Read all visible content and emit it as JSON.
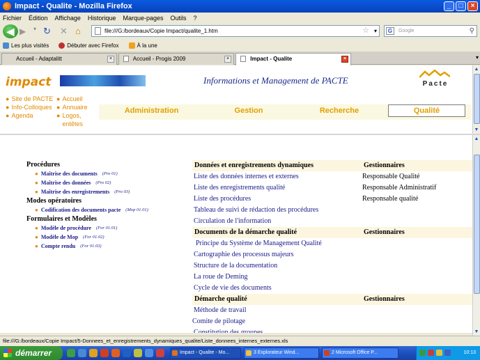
{
  "window": {
    "title": "Impact - Qualite - Mozilla Firefox",
    "buttons": [
      "_",
      "□",
      "×"
    ]
  },
  "menu": [
    "Fichier",
    "Édition",
    "Affichage",
    "Historique",
    "Marque-pages",
    "Outils",
    "?"
  ],
  "nav": {
    "url": "file:///G:/bordeaux/Copie Impact/qualite_1.htm",
    "search_placeholder": "Google"
  },
  "bookmarks": [
    "Les plus visités",
    "Débuter avec Firefox",
    "À la une"
  ],
  "tabs": [
    {
      "label": "Accueil - Adaptalitt"
    },
    {
      "label": "Accueil - Progis 2009"
    },
    {
      "label": "Impact - Qualite",
      "active": true
    }
  ],
  "header": {
    "logo": "impact",
    "title": "Informations et Management de PACTE",
    "pacte_logo": "Pacte",
    "left_links_col1": [
      "Site de PACTE",
      "Info-Colloques",
      "Agenda"
    ],
    "left_links_col2": [
      "Accueil",
      "Annuaire",
      "Logos,",
      "entêtes"
    ],
    "main_nav": [
      "Administration",
      "Gestion",
      "Recherche",
      "Qualité"
    ],
    "main_nav_selected": "Qualité"
  },
  "left_panel": {
    "sections": [
      {
        "heading": "Procédures",
        "items": [
          {
            "label": "Maîtrise des documents",
            "version": "(Pro 01)"
          },
          {
            "label": "Maîtrise des données",
            "version": "(Pro 02)"
          },
          {
            "label": "Maîtrise des enregistrements",
            "version": "(Pro 03)"
          }
        ]
      },
      {
        "heading": "Modes opératoires",
        "items": [
          {
            "label": "Codification des documents pacte",
            "version": "(Mop 01.01)"
          }
        ]
      },
      {
        "heading": "Formulaires et Modèles",
        "items": [
          {
            "label": "Modèle de procédure",
            "version": "(For 01.01)"
          },
          {
            "label": "Modèle de Mop",
            "version": "(For 01.02)"
          },
          {
            "label": "Compte rendu",
            "version": "(For 01.03)"
          }
        ]
      }
    ]
  },
  "table": {
    "sections": [
      {
        "heading": "Données et enregistrements dynamiques",
        "col2": "Gestionnaires",
        "rows": [
          {
            "doc": "Liste des données internes et externes",
            "owner": "Responsable Qualité"
          },
          {
            "doc": "Liste des enregistrements qualité",
            "owner": "Responsable Administratif"
          },
          {
            "doc": "Liste des procédures",
            "owner": "Responsable qualité"
          },
          {
            "doc": "Tableau de suivi de rédaction des procédures",
            "owner": ""
          },
          {
            "doc": "Circulation de l'information",
            "owner": ""
          }
        ]
      },
      {
        "heading": "Documents de la démarche qualité",
        "col2": "Gestionnaires",
        "rows": [
          {
            "doc": "Principe du Système de Management Qualité",
            "owner": ""
          },
          {
            "doc": "Cartographie des processus majeurs",
            "owner": ""
          },
          {
            "doc": "Structure de la documentation",
            "owner": ""
          },
          {
            "doc": "La roue de Deming",
            "owner": ""
          },
          {
            "doc": "Cycle de vie des documents",
            "owner": ""
          }
        ]
      },
      {
        "heading": "Démarche qualité",
        "col2": "Gestionnaires",
        "rows": [
          {
            "doc": "Méthode de travail",
            "owner": ""
          },
          {
            "doc": "Comite de pilotage",
            "owner": ""
          },
          {
            "doc": "Constitution des groupes",
            "owner": ""
          }
        ]
      }
    ]
  },
  "status": "file:///G:/bordeaux/Copie Impact/5-Donnees_et_enregistrements_dynamiques_qualite/Liste_donnees_internes_externes.xls",
  "taskbar": {
    "start": "démarrer",
    "tasks": [
      "Impact - Qualite - Mo...",
      "3 Explorateur Wind...",
      "2 Microsoft Office P..."
    ],
    "clock": "10:13"
  },
  "colors": {
    "accent": "#e08a00",
    "nav_text": "#e0a000",
    "link": "#1a1a8a",
    "title_blue": "#1a2a8a"
  }
}
